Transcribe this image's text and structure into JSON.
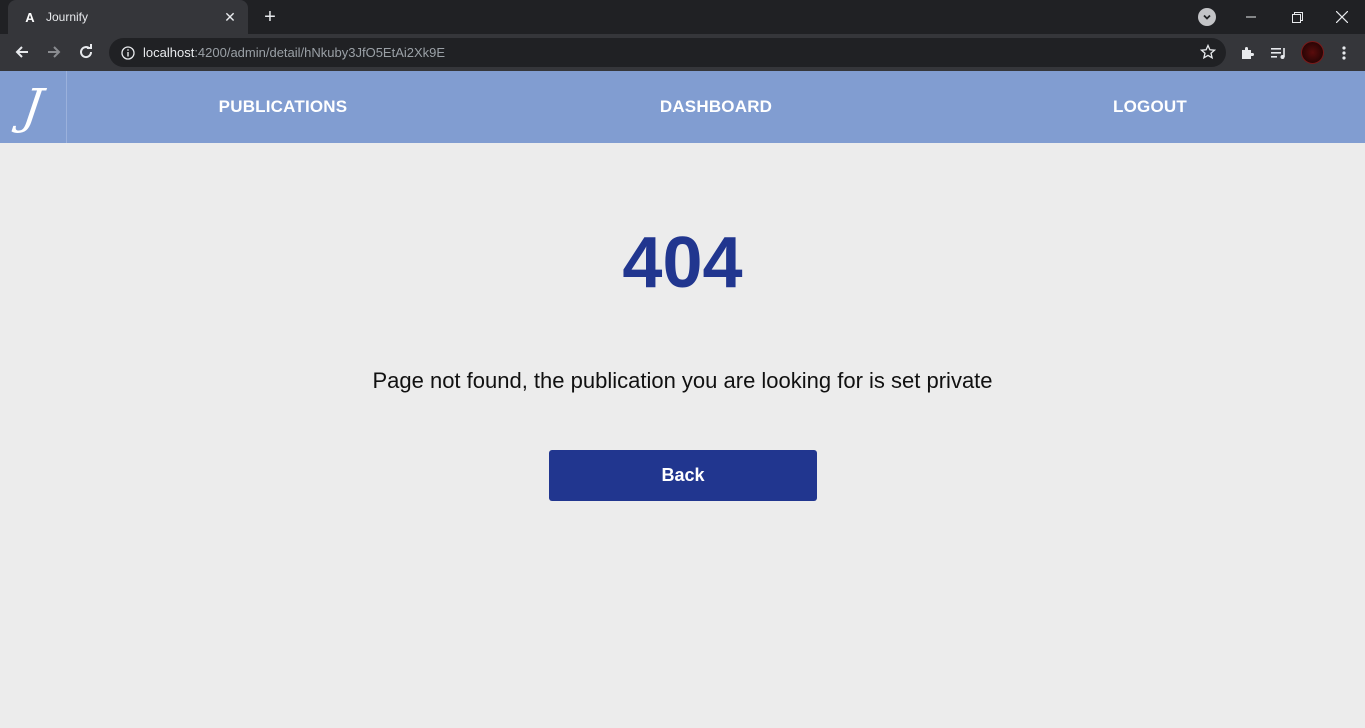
{
  "browser": {
    "tab_title": "Journify",
    "tab_favicon": "A",
    "url_host": "localhost",
    "url_rest": ":4200/admin/detail/hNkuby3JfO5EtAi2Xk9E"
  },
  "navbar": {
    "logo_letter": "J",
    "links": [
      {
        "label": "PUBLICATIONS"
      },
      {
        "label": "DASHBOARD"
      },
      {
        "label": "LOGOUT"
      }
    ]
  },
  "error": {
    "code": "404",
    "message": "Page not found, the publication you are looking for is set private",
    "back_label": "Back"
  },
  "colors": {
    "navbar": "#819dd1",
    "primary": "#21368f",
    "background": "#ececec"
  }
}
